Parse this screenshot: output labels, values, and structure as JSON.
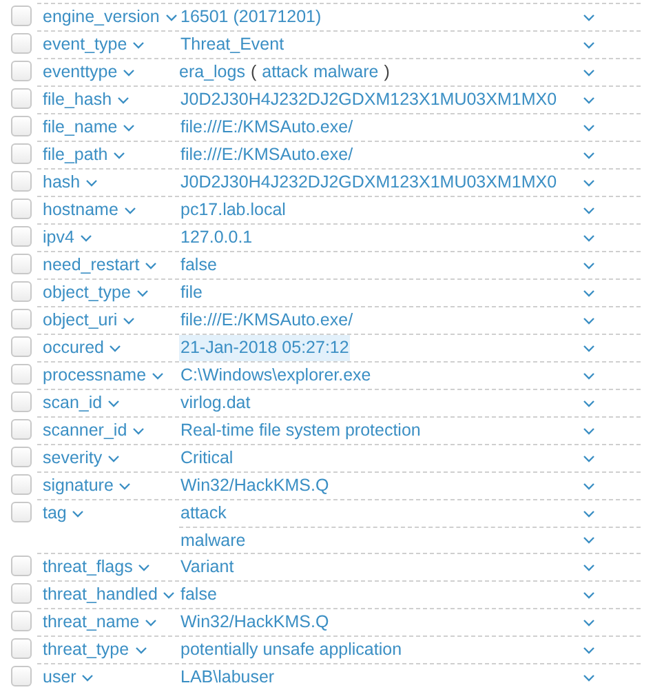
{
  "rows": [
    {
      "field": "engine_version",
      "checked": false,
      "values": [
        {
          "text": "16501 (20171201)",
          "highlighted": false
        }
      ]
    },
    {
      "field": "event_type",
      "checked": false,
      "values": [
        {
          "text": "Threat_Event",
          "highlighted": false
        }
      ]
    },
    {
      "field": "eventtype",
      "checked": false,
      "values": [
        {
          "parts": [
            {
              "kind": "link",
              "text": "era_logs"
            },
            {
              "kind": "punct",
              "text": "("
            },
            {
              "kind": "link",
              "text": "attack"
            },
            {
              "kind": "link",
              "text": "malware"
            },
            {
              "kind": "punct",
              "text": ")"
            }
          ]
        }
      ]
    },
    {
      "field": "file_hash",
      "checked": false,
      "values": [
        {
          "text": "J0D2J30H4J232DJ2GDXM123X1MU03XM1MX0",
          "highlighted": false
        }
      ]
    },
    {
      "field": "file_name",
      "checked": false,
      "values": [
        {
          "text": "file:///E:/KMSAuto.exe/",
          "highlighted": false
        }
      ]
    },
    {
      "field": "file_path",
      "checked": false,
      "values": [
        {
          "text": "file:///E:/KMSAuto.exe/",
          "highlighted": false
        }
      ]
    },
    {
      "field": "hash",
      "checked": false,
      "values": [
        {
          "text": "J0D2J30H4J232DJ2GDXM123X1MU03XM1MX0",
          "highlighted": false
        }
      ]
    },
    {
      "field": "hostname",
      "checked": false,
      "values": [
        {
          "text": "pc17.lab.local",
          "highlighted": false
        }
      ]
    },
    {
      "field": "ipv4",
      "checked": false,
      "values": [
        {
          "text": "127.0.0.1",
          "highlighted": false
        }
      ]
    },
    {
      "field": "need_restart",
      "checked": false,
      "values": [
        {
          "text": "false",
          "highlighted": false
        }
      ]
    },
    {
      "field": "object_type",
      "checked": false,
      "values": [
        {
          "text": "file",
          "highlighted": false
        }
      ]
    },
    {
      "field": "object_uri",
      "checked": false,
      "values": [
        {
          "text": "file:///E:/KMSAuto.exe/",
          "highlighted": false
        }
      ]
    },
    {
      "field": "occured",
      "checked": false,
      "values": [
        {
          "text": "21-Jan-2018 05:27:12",
          "highlighted": true
        }
      ]
    },
    {
      "field": "processname",
      "checked": false,
      "values": [
        {
          "text": "C:\\Windows\\explorer.exe",
          "highlighted": false
        }
      ]
    },
    {
      "field": "scan_id",
      "checked": false,
      "values": [
        {
          "text": "virlog.dat",
          "highlighted": false
        }
      ]
    },
    {
      "field": "scanner_id",
      "checked": false,
      "values": [
        {
          "text": "Real-time file system protection",
          "highlighted": false
        }
      ]
    },
    {
      "field": "severity",
      "checked": false,
      "values": [
        {
          "text": "Critical",
          "highlighted": false
        }
      ]
    },
    {
      "field": "signature",
      "checked": false,
      "values": [
        {
          "text": "Win32/HackKMS.Q",
          "highlighted": false
        }
      ]
    },
    {
      "field": "tag",
      "checked": false,
      "values": [
        {
          "text": "attack",
          "highlighted": false
        },
        {
          "text": "malware",
          "highlighted": false
        }
      ]
    },
    {
      "field": "threat_flags",
      "checked": false,
      "values": [
        {
          "text": "Variant",
          "highlighted": false
        }
      ]
    },
    {
      "field": "threat_handled",
      "checked": false,
      "values": [
        {
          "text": "false",
          "highlighted": false
        }
      ]
    },
    {
      "field": "threat_name",
      "checked": false,
      "values": [
        {
          "text": "Win32/HackKMS.Q",
          "highlighted": false
        }
      ]
    },
    {
      "field": "threat_type",
      "checked": false,
      "values": [
        {
          "text": "potentially unsafe application",
          "highlighted": false
        }
      ]
    },
    {
      "field": "user",
      "checked": false,
      "values": [
        {
          "text": "LAB\\labuser",
          "highlighted": false
        }
      ]
    }
  ]
}
